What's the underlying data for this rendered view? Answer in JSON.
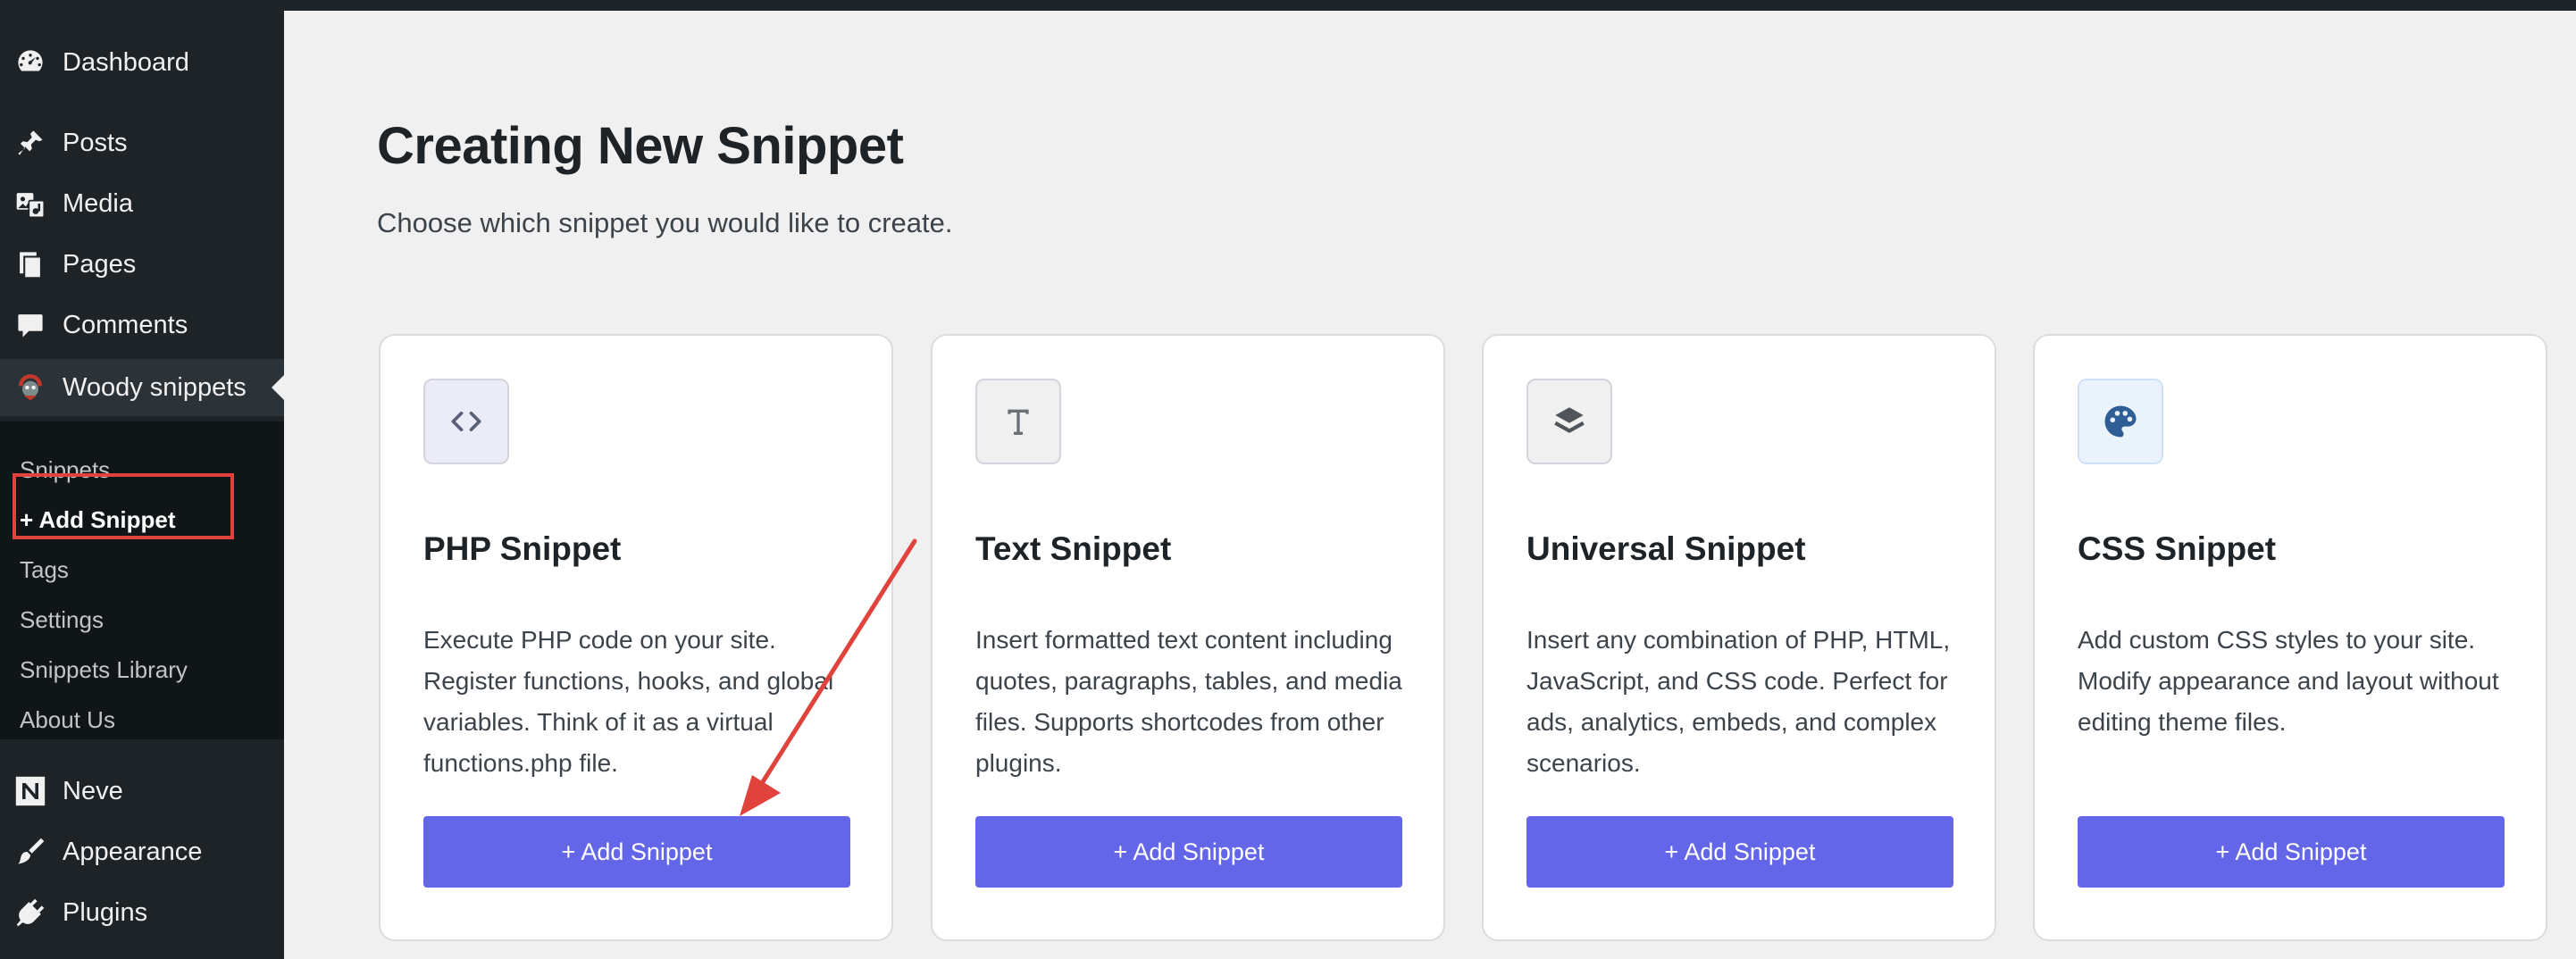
{
  "sidebar": {
    "items": [
      {
        "label": "Dashboard",
        "icon": "dashboard-icon"
      },
      {
        "label": "Posts",
        "icon": "pin-icon"
      },
      {
        "label": "Media",
        "icon": "media-icon"
      },
      {
        "label": "Pages",
        "icon": "pages-icon"
      },
      {
        "label": "Comments",
        "icon": "comment-icon"
      },
      {
        "label": "Woody snippets",
        "icon": "woody-logo-icon"
      },
      {
        "label": "Neve",
        "icon": "neve-logo-icon"
      },
      {
        "label": "Appearance",
        "icon": "brush-icon"
      },
      {
        "label": "Plugins",
        "icon": "plug-icon"
      }
    ],
    "submenu": [
      "Snippets",
      "+ Add Snippet",
      "Tags",
      "Settings",
      "Snippets Library",
      "About Us"
    ]
  },
  "main": {
    "title": "Creating New Snippet",
    "subtitle": "Choose which snippet you would like to create."
  },
  "cards": [
    {
      "title": "PHP Snippet",
      "icon": "code-icon",
      "icon_bg": "#ececf8",
      "description": "Execute PHP code on your site. Register functions, hooks, and global variables. Think of it as a virtual functions.php file.",
      "button": "+ Add Snippet"
    },
    {
      "title": "Text Snippet",
      "icon": "text-icon",
      "icon_bg": "#f0f0f1",
      "description": "Insert formatted text content including quotes, paragraphs, tables, and media files. Supports shortcodes from other plugins.",
      "button": "+ Add Snippet"
    },
    {
      "title": "Universal Snippet",
      "icon": "layers-icon",
      "icon_bg": "#f0f0f1",
      "description": "Insert any combination of PHP, HTML, JavaScript, and CSS code. Perfect for ads, analytics, embeds, and complex scenarios.",
      "button": "+ Add Snippet"
    },
    {
      "title": "CSS Snippet",
      "icon": "palette-icon",
      "icon_bg": "#eaf3fc",
      "description": "Add custom CSS styles to your site. Modify appearance and layout without editing theme files.",
      "button": "+ Add Snippet"
    }
  ],
  "colors": {
    "accent": "#6366e8",
    "annotation": "#e0433b"
  }
}
